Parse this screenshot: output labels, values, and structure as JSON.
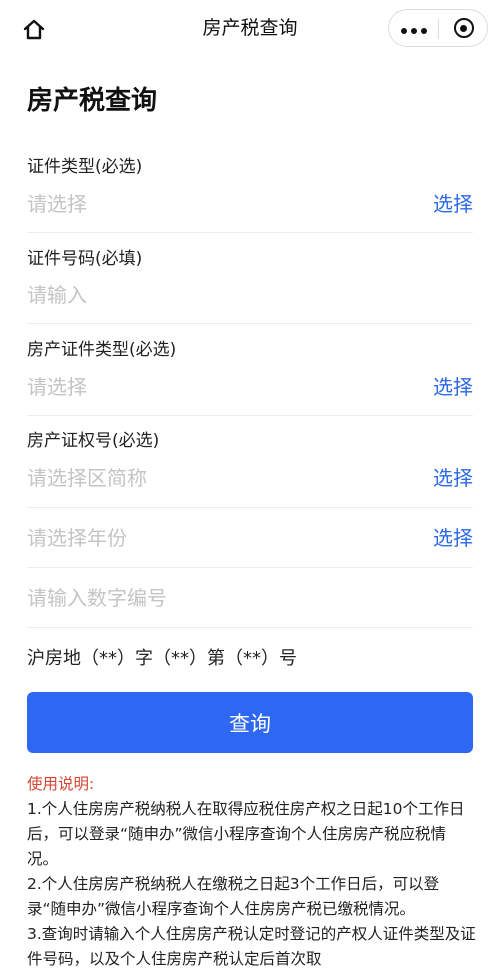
{
  "navbar": {
    "title": "房产税查询",
    "home_icon": "home-icon",
    "more_icon": "more-dots-icon",
    "close_icon": "target-close-icon"
  },
  "page": {
    "title": "房产税查询"
  },
  "form": {
    "id_type": {
      "label": "证件类型(必选)",
      "placeholder": "请选择",
      "action": "选择"
    },
    "id_number": {
      "label": "证件号码(必填)",
      "placeholder": "请输入"
    },
    "property_cert_type": {
      "label": "房产证件类型(必选)",
      "placeholder": "请选择",
      "action": "选择"
    },
    "property_cert_no": {
      "label": "房产证权号(必选)",
      "district_placeholder": "请选择区简称",
      "district_action": "选择",
      "year_placeholder": "请选择年份",
      "year_action": "选择",
      "number_placeholder": "请输入数字编号"
    },
    "cert_template": "沪房地（**）字（**）第（**）号",
    "submit_label": "查询"
  },
  "instructions": {
    "title": "使用说明:",
    "items": [
      "1.个人住房房产税纳税人在取得应税住房产权之日起10个工作日后，可以登录“随申办”微信小程序查询个人住房房产税应税情况。",
      "2.个人住房房产税纳税人在缴税之日起3个工作日后，可以登录“随申办”微信小程序查询个人住房房产税已缴税情况。",
      "3.查询时请输入个人住房房产税认定时登记的产权人证件类型及证件号码，以及个人住房房产税认定后首次取"
    ]
  },
  "colors": {
    "accent": "#2e67f1",
    "link": "#2c6ae8",
    "instruction_title": "#d64531",
    "placeholder": "#c4c4c4"
  }
}
